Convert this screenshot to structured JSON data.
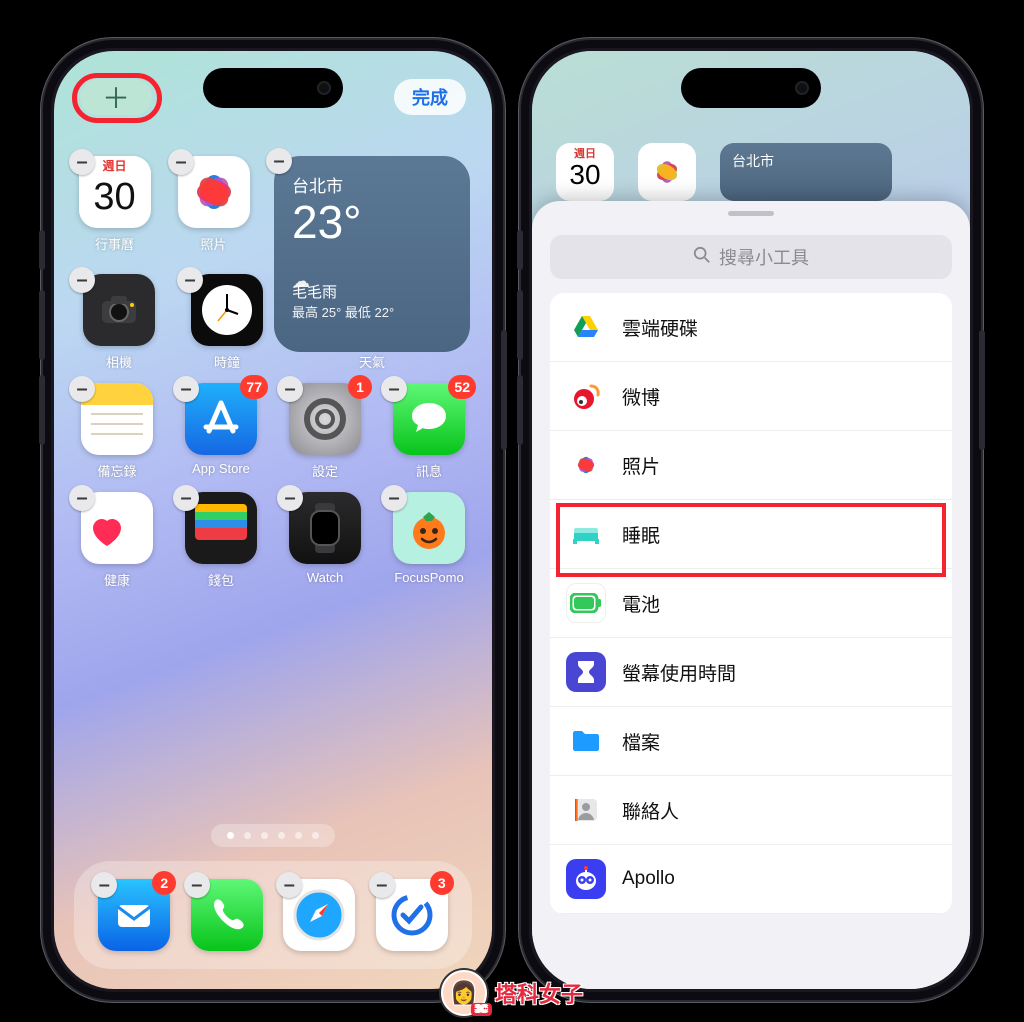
{
  "left_phone": {
    "add_button_glyph": "＋",
    "done_label": "完成",
    "calendar_widget": {
      "weekday": "週日",
      "day": "30",
      "label": "行事曆"
    },
    "weather_widget": {
      "city": "台北市",
      "temp": "23°",
      "condition": "毛毛雨",
      "range": "最高 25° 最低 22°",
      "label": "天氣"
    },
    "apps_row1": [
      {
        "name": "照片",
        "icon": "photos"
      }
    ],
    "apps_row2": [
      {
        "name": "相機",
        "icon": "camera"
      },
      {
        "name": "時鐘",
        "icon": "clock"
      }
    ],
    "apps_row3": [
      {
        "name": "備忘錄",
        "icon": "notes"
      },
      {
        "name": "App Store",
        "icon": "appstore",
        "badge": "77"
      },
      {
        "name": "設定",
        "icon": "settings",
        "badge": "1"
      },
      {
        "name": "訊息",
        "icon": "messages",
        "badge": "52"
      }
    ],
    "apps_row4": [
      {
        "name": "健康",
        "icon": "health"
      },
      {
        "name": "錢包",
        "icon": "wallet"
      },
      {
        "name": "Watch",
        "icon": "watch"
      },
      {
        "name": "FocusPomo",
        "icon": "focuspomo"
      }
    ],
    "dock": [
      {
        "name": "Mail",
        "icon": "mail",
        "badge": "2"
      },
      {
        "name": "Phone",
        "icon": "phone"
      },
      {
        "name": "Safari",
        "icon": "safari"
      },
      {
        "name": "TickTick",
        "icon": "ticktick",
        "badge": "3"
      }
    ],
    "page_count": 6,
    "active_page": 0
  },
  "right_phone": {
    "mini_calendar_weekday": "週日",
    "mini_calendar_day": "30",
    "mini_weather_city": "台北市",
    "search_placeholder": "搜尋小工具",
    "widget_list": [
      {
        "name": "雲端硬碟",
        "icon": "gdrive"
      },
      {
        "name": "微博",
        "icon": "weibo"
      },
      {
        "name": "照片",
        "icon": "photos"
      },
      {
        "name": "睡眠",
        "icon": "sleep",
        "highlighted": true
      },
      {
        "name": "電池",
        "icon": "battery"
      },
      {
        "name": "螢幕使用時間",
        "icon": "screentime"
      },
      {
        "name": "檔案",
        "icon": "files"
      },
      {
        "name": "聯絡人",
        "icon": "contacts"
      },
      {
        "name": "Apollo",
        "icon": "apollo"
      }
    ]
  },
  "watermark": {
    "text": "塔科女子",
    "badge": "3C"
  }
}
